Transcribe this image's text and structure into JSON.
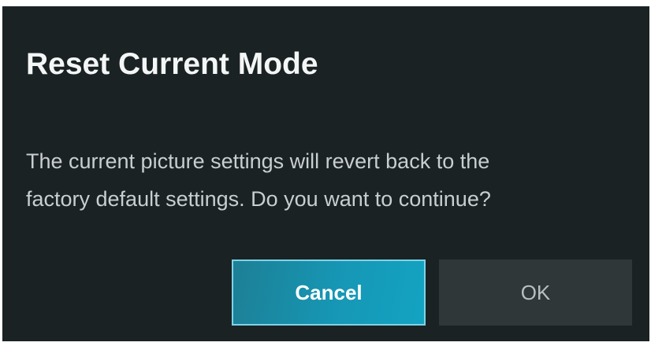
{
  "dialog": {
    "title": "Reset Current Mode",
    "message_lines": [
      "The current picture settings will revert back to the",
      "factory default settings. Do you want to continue?"
    ],
    "buttons": {
      "cancel_label": "Cancel",
      "ok_label": "OK"
    },
    "focused_button": "cancel"
  },
  "colors": {
    "background": "#1a2224",
    "focused_button": "#1697b5",
    "unfocused_button": "#2f3739",
    "title_text": "#f4f6f6",
    "body_text": "#c9cecf"
  }
}
